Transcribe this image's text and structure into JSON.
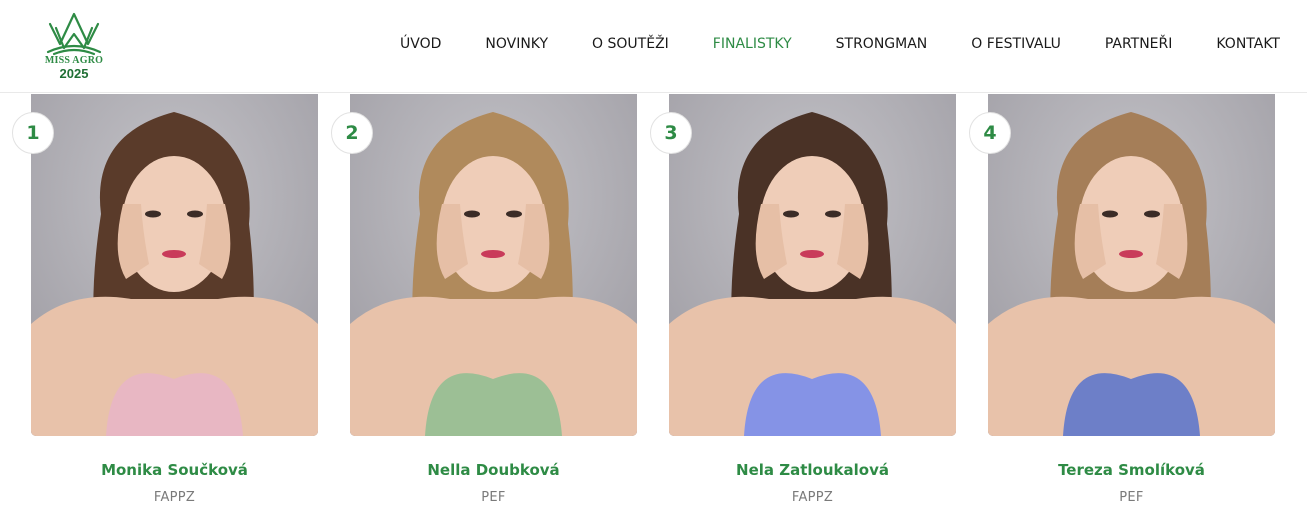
{
  "logo": {
    "line1": "MISS AGRO",
    "line2": "2025",
    "icon": "crown-icon",
    "color": "#2e8b45"
  },
  "nav": {
    "items": [
      {
        "label": "ÚVOD",
        "active": false
      },
      {
        "label": "NOVINKY",
        "active": false
      },
      {
        "label": "O SOUTĚŽI",
        "active": false
      },
      {
        "label": "FINALISTKY",
        "active": true
      },
      {
        "label": "STRONGMAN",
        "active": false
      },
      {
        "label": "O FESTIVALU",
        "active": false
      },
      {
        "label": "PARTNEŘI",
        "active": false
      },
      {
        "label": "KONTAKT",
        "active": false
      }
    ],
    "active_color": "#2e8b45"
  },
  "finalists": [
    {
      "number": "1",
      "name": "Monika Součková",
      "faculty": "FAPPZ",
      "hair_color": "#5a3b2a",
      "dress_color": "#e8b7c3"
    },
    {
      "number": "2",
      "name": "Nella Doubková",
      "faculty": "PEF",
      "hair_color": "#b08a5c",
      "dress_color": "#9cbf95"
    },
    {
      "number": "3",
      "name": "Nela Zatloukalová",
      "faculty": "FAPPZ",
      "hair_color": "#4a3226",
      "dress_color": "#8593e6"
    },
    {
      "number": "4",
      "name": "Tereza Smolíková",
      "faculty": "PEF",
      "hair_color": "#a57e58",
      "dress_color": "#6d7fc8"
    }
  ]
}
